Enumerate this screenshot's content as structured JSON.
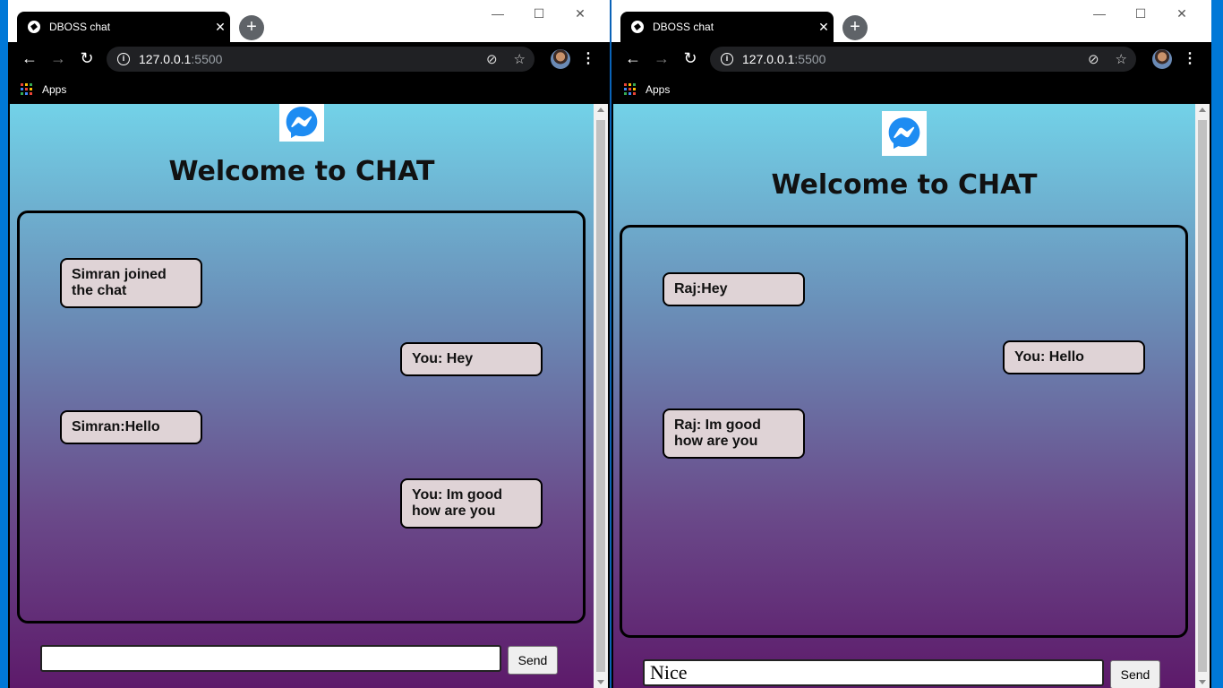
{
  "windows": [
    {
      "tab_title": "DBOSS chat",
      "url_host": "127.0.0.1",
      "url_port": ":5500",
      "bookmark_label": "Apps",
      "heading": "Welcome to CHAT",
      "messages": [
        "Simran joined the chat",
        "You: Hey",
        "Simran:Hello",
        "You: Im good how are you"
      ],
      "input_value": "",
      "send_label": "Send"
    },
    {
      "tab_title": "DBOSS chat",
      "url_host": "127.0.0.1",
      "url_port": ":5500",
      "bookmark_label": "Apps",
      "heading": "Welcome to CHAT",
      "messages": [
        "Raj:Hey",
        "You: Hello",
        "Raj: Im good how are you"
      ],
      "input_value": "Nice",
      "send_label": "Send"
    }
  ],
  "icons": {
    "tab_close": "close-icon",
    "new_tab": "plus-icon",
    "back": "arrow-left-icon",
    "forward": "arrow-right-icon",
    "reload": "reload-icon",
    "site_info": "info-icon",
    "tracking": "eye-off-icon",
    "bookmark": "star-icon",
    "menu": "more-vertical-icon",
    "logo": "messenger-icon"
  },
  "colors": {
    "gradient_top": "#72d2e8",
    "gradient_bottom": "#5d1a6a",
    "bubble": "#dfd3d6",
    "messenger_blue": "#1e8cf2"
  }
}
